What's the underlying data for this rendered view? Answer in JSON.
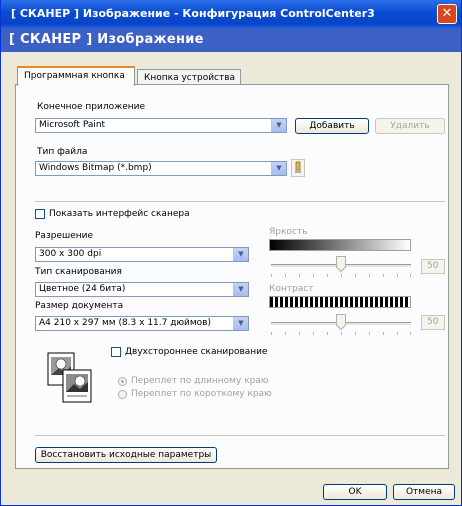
{
  "window": {
    "title": "[ СКАНЕР ] Изображение - Конфигурация ControlCenter3",
    "close_icon": "close-icon"
  },
  "header": {
    "title": "[ СКАНЕР ] Изображение"
  },
  "tabs": [
    {
      "label": "Программная кнопка",
      "active": true
    },
    {
      "label": "Кнопка устройства",
      "active": false
    }
  ],
  "target_app": {
    "label": "Конечное приложение",
    "value": "Microsoft Paint",
    "add_label": "Добавить",
    "delete_label": "Удалить"
  },
  "file_type": {
    "label": "Тип файла",
    "value": "Windows Bitmap (*.bmp)",
    "help_icon": "help-icon"
  },
  "show_scanner_interface": {
    "label": "Показать интерфейс сканера",
    "checked": false
  },
  "resolution": {
    "label": "Разрешение",
    "value": "300 x 300 dpi"
  },
  "scan_type": {
    "label": "Тип сканирования",
    "value": "Цветное (24 бита)"
  },
  "doc_size": {
    "label": "Размер документа",
    "value": "A4 210 x 297 мм (8.3 x 11.7 дюймов)"
  },
  "brightness": {
    "label": "Яркость",
    "value": "50",
    "level": 0.5
  },
  "contrast": {
    "label": "Контраст",
    "value": "50",
    "level": 0.5
  },
  "duplex": {
    "label": "Двухстороннее сканирование",
    "checked": false,
    "option_long": "Переплет по длинному краю",
    "option_short": "Переплет по короткому краю",
    "selected": "long"
  },
  "reset_label": "Восстановить исходные параметры",
  "ok_label": "OK",
  "cancel_label": "Отмена",
  "colors": {
    "title_bar": "#0a4cd1",
    "header": "#3b61c4",
    "window_bg": "#ece9d8",
    "close": "#d8481e"
  }
}
